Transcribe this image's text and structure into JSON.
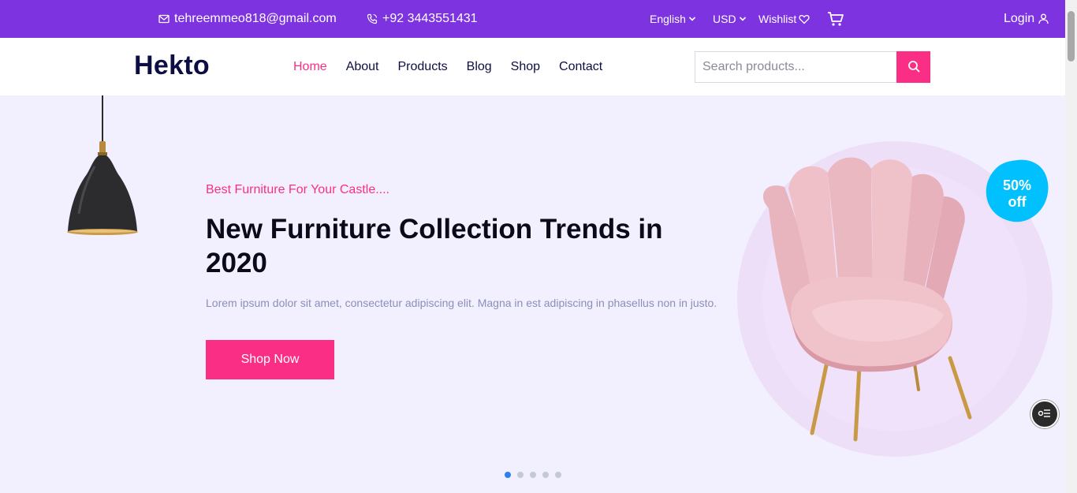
{
  "topbar": {
    "email": "tehreemmeo818@gmail.com",
    "phone": "+92 3443551431",
    "language": "English",
    "currency": "USD",
    "wishlist": "Wishlist",
    "login": "Login",
    "icons": [
      "mail-icon",
      "phone-icon",
      "chevron-down-icon",
      "heart-icon",
      "cart-icon",
      "user-icon"
    ]
  },
  "nav": {
    "logo": "Hekto",
    "items": [
      "Home",
      "About",
      "Products",
      "Blog",
      "Shop",
      "Contact"
    ],
    "active": "Home",
    "search_placeholder": "Search products..."
  },
  "hero": {
    "subtitle": "Best Furniture For Your Castle....",
    "title": "New Furniture Collection Trends in 2020",
    "description": "Lorem ipsum dolor sit amet, consectetur adipiscing elit. Magna in est adipiscing in phasellus non in justo.",
    "button": "Shop Now",
    "discount_line1": "50%",
    "discount_line2": "off",
    "slides_total": 5,
    "active_slide": 1
  },
  "colors": {
    "topbar": "#7e33e0",
    "accent": "#fb2e86",
    "navy": "#0d0e43",
    "hero_bg": "#f2f0ff",
    "badge": "#00c1fe"
  }
}
